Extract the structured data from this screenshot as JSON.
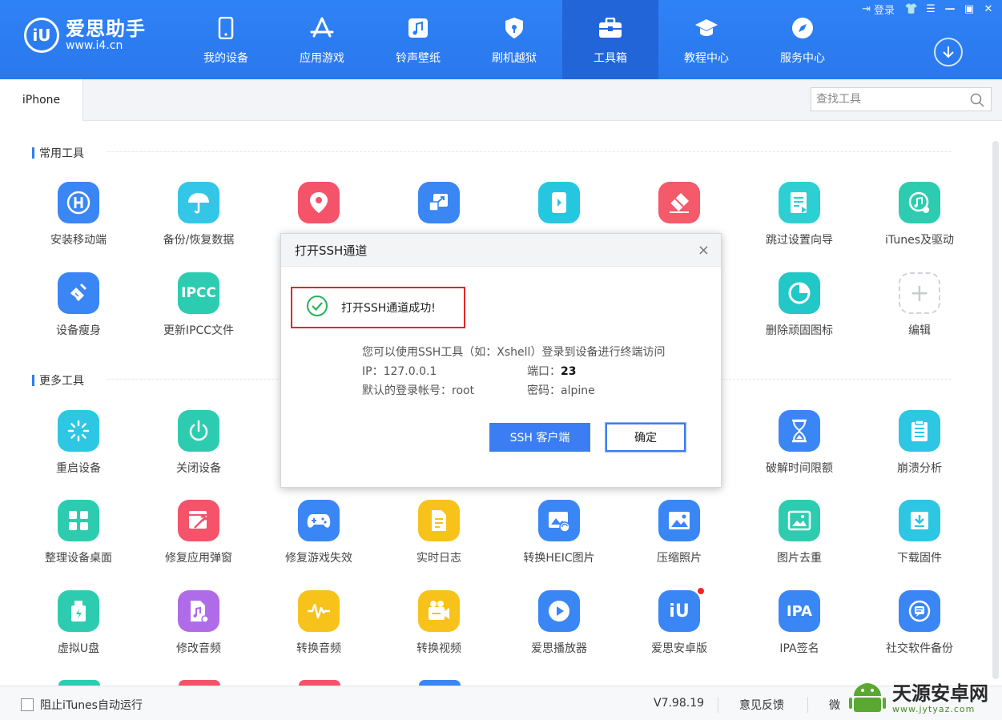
{
  "app": {
    "logo_text": "爱思助手",
    "logo_url": "www.i4.cn",
    "login": "登录"
  },
  "nav": [
    {
      "label": "我的设备",
      "icon": "phone-icon"
    },
    {
      "label": "应用游戏",
      "icon": "appstore-icon"
    },
    {
      "label": "铃声壁纸",
      "icon": "music-icon"
    },
    {
      "label": "刷机越狱",
      "icon": "shield-icon"
    },
    {
      "label": "工具箱",
      "icon": "toolbox-icon",
      "active": true
    },
    {
      "label": "教程中心",
      "icon": "graduation-cap-icon"
    },
    {
      "label": "服务中心",
      "icon": "compass-icon"
    }
  ],
  "tab": {
    "label": "iPhone"
  },
  "search": {
    "placeholder": "查找工具"
  },
  "sections": {
    "common": "常用工具",
    "more": "更多工具"
  },
  "common_tools": [
    {
      "label": "安装移动端",
      "icon": "i4-install-icon",
      "color": "#3a86f5"
    },
    {
      "label": "备份/恢复数据",
      "icon": "umbrella-icon",
      "color": "#34c6e6"
    },
    {
      "label": "",
      "icon": "location-pin-icon",
      "color": "#f4536a"
    },
    {
      "label": "",
      "icon": "screen-mirror-icon",
      "color": "#3a86f5"
    },
    {
      "label": "",
      "icon": "phone-screen-icon",
      "color": "#26c6e0"
    },
    {
      "label": "",
      "icon": "eraser-icon",
      "color": "#f45a6a"
    },
    {
      "label": "跳过设置向导",
      "icon": "setup-guide-icon",
      "color": "#2ecfd2"
    },
    {
      "label": "iTunes及驱动",
      "icon": "itunes-icon",
      "color": "#2dccb0"
    },
    {
      "label": "设备瘦身",
      "icon": "broom-icon",
      "color": "#3a86f5"
    },
    {
      "label": "更新IPCC文件",
      "icon": "ipcc-icon",
      "color": "#2dccb0"
    },
    {
      "label": "删除顽固图标",
      "icon": "pie-chart-icon",
      "color": "#22c7c7"
    },
    {
      "label": "编辑",
      "icon": "plus-icon"
    }
  ],
  "more_tools": [
    {
      "label": "重启设备",
      "icon": "restart-icon",
      "color": "#2dc6e3"
    },
    {
      "label": "关闭设备",
      "icon": "power-icon",
      "color": "#2dccb0"
    },
    {
      "label": "破解时间限额",
      "icon": "hourglass-icon",
      "color": "#3a86f5"
    },
    {
      "label": "崩溃分析",
      "icon": "clipboard-icon",
      "color": "#2dc6e3"
    },
    {
      "label": "整理设备桌面",
      "icon": "grid-icon",
      "color": "#2dccb0"
    },
    {
      "label": "修复应用弹窗",
      "icon": "wrench-icon",
      "color": "#f4536a"
    },
    {
      "label": "修复游戏失效",
      "icon": "gamepad-icon",
      "color": "#3a86f5"
    },
    {
      "label": "实时日志",
      "icon": "document-icon",
      "color": "#f7c21a"
    },
    {
      "label": "转换HEIC图片",
      "icon": "heic-icon",
      "color": "#3a86f5"
    },
    {
      "label": "压缩照片",
      "icon": "photo-icon",
      "color": "#3a86f5"
    },
    {
      "label": "图片去重",
      "icon": "gallery-icon",
      "color": "#2dccb0"
    },
    {
      "label": "下载固件",
      "icon": "download-box-icon",
      "color": "#2dc6e3"
    },
    {
      "label": "虚拟U盘",
      "icon": "usb-icon",
      "color": "#2dccb0"
    },
    {
      "label": "修改音频",
      "icon": "audio-file-icon",
      "color": "#b06ce8"
    },
    {
      "label": "转换音频",
      "icon": "waveform-icon",
      "color": "#f7c21a"
    },
    {
      "label": "转换视频",
      "icon": "video-icon",
      "color": "#f7c21a"
    },
    {
      "label": "爱思播放器",
      "icon": "play-icon",
      "color": "#3a86f5"
    },
    {
      "label": "爱思安卓版",
      "icon": "android-i4-icon",
      "color": "#3a86f5"
    },
    {
      "label": "IPA签名",
      "icon": "ipa-icon",
      "color": "#3a86f5"
    },
    {
      "label": "社交软件备份",
      "icon": "chat-backup-icon",
      "color": "#3a86f5"
    }
  ],
  "modal": {
    "title": "打开SSH通道",
    "close": "×",
    "success": "打开SSH通道成功!",
    "line1": "您可以使用SSH工具（如：Xshell）登录到设备进行终端访问",
    "ip_label": "IP：127.0.0.1",
    "port_label": "端口：",
    "port_value": "23",
    "account_label": "默认的登录帐号：root",
    "password_label": "密码：alpine",
    "btn_ssh": "SSH 客户端",
    "btn_ok": "确定"
  },
  "bottom": {
    "checkbox_label": "阻止iTunes自动运行",
    "version": "V7.98.19",
    "feedback": "意见反馈",
    "wechat": "微"
  },
  "watermark": {
    "title": "天源安卓网",
    "url": "www.jytyaz.com"
  },
  "colors": {
    "brand": "#2a7ef4",
    "highlight_red": "#e0262c"
  }
}
